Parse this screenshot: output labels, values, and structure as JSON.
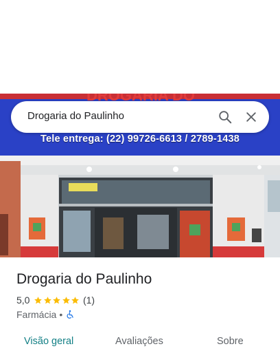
{
  "search": {
    "query": "Drogaria do Paulinho"
  },
  "photo": {
    "sign_name": "DROGARIA DO",
    "tagline": "Tele entrega: (22) 99726-6613 / 2789-1438"
  },
  "place": {
    "name": "Drogaria do Paulinho",
    "rating": "5,0",
    "stars": 5,
    "review_count": "(1)",
    "category": "Farmácia",
    "separator": "•",
    "accessibility_icon": "wheelchair-icon"
  },
  "tabs": [
    {
      "label": "Visão geral",
      "active": true
    },
    {
      "label": "Avaliações",
      "active": false
    },
    {
      "label": "Sobre",
      "active": false
    }
  ],
  "colors": {
    "accent": "#127f85",
    "star": "#fbbc04",
    "sign_blue": "#2a41c6",
    "accessibility_blue": "#1a73e8"
  }
}
